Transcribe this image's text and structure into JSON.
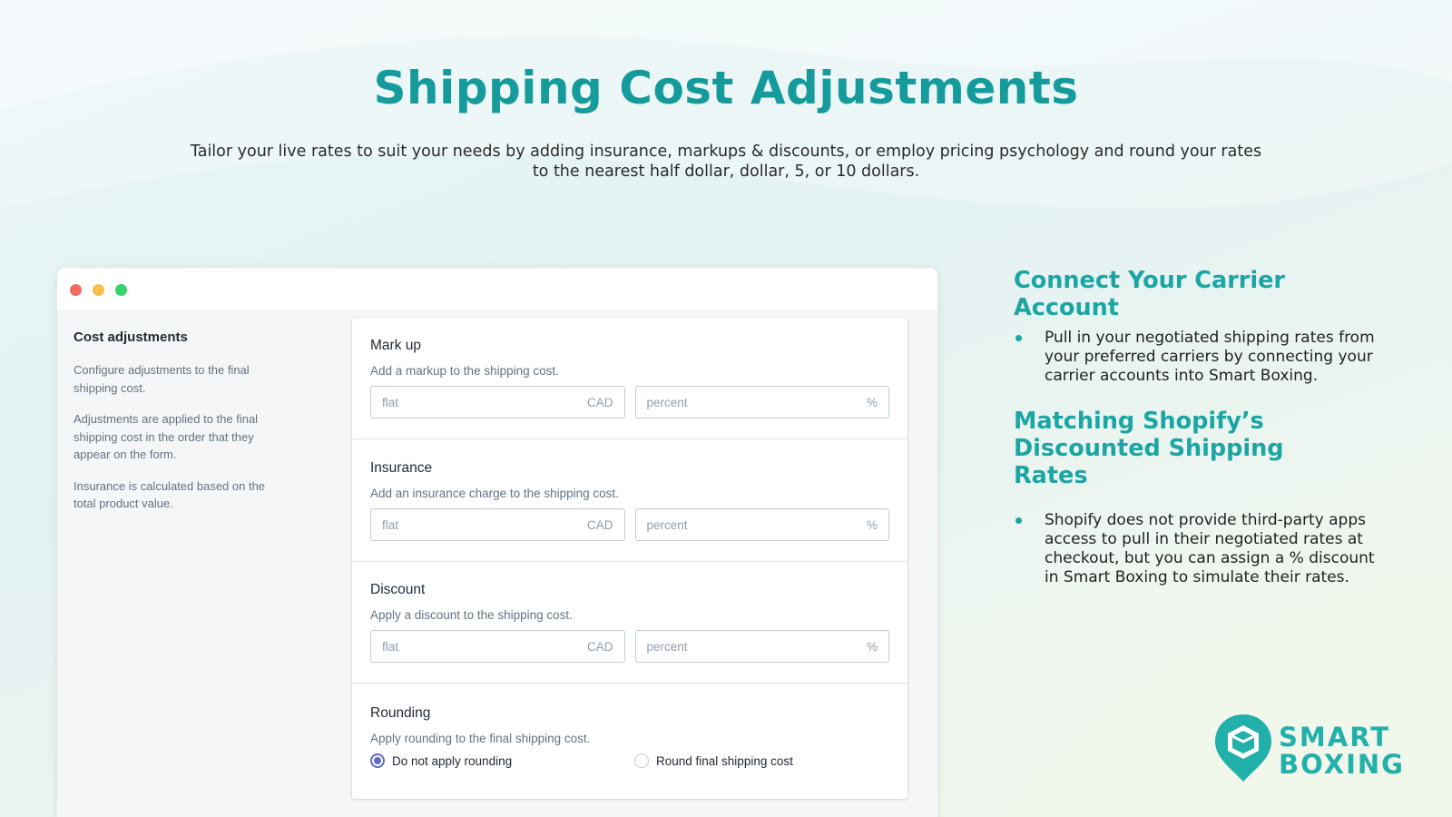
{
  "hero": {
    "title": "Shipping Cost Adjustments",
    "subtitle": "Tailor your live rates to suit your needs by adding insurance, markups & discounts, or employ pricing psychology and round your rates to the nearest half dollar, dollar, 5, or 10 dollars."
  },
  "window": {
    "sidebar": {
      "title": "Cost adjustments",
      "paragraphs": [
        "Configure adjustments to the final shipping cost.",
        "Adjustments are applied to the final shipping cost in the order that they appear on the form.",
        "Insurance is calculated based on the total product value."
      ]
    },
    "sections": {
      "markup": {
        "title": "Mark up",
        "help": "Add a markup to the shipping cost.",
        "flat_placeholder": "flat",
        "flat_suffix": "CAD",
        "percent_placeholder": "percent",
        "percent_suffix": "%"
      },
      "insurance": {
        "title": "Insurance",
        "help": "Add an insurance charge to the shipping cost.",
        "flat_placeholder": "flat",
        "flat_suffix": "CAD",
        "percent_placeholder": "percent",
        "percent_suffix": "%"
      },
      "discount": {
        "title": "Discount",
        "help": "Apply a discount to the shipping cost.",
        "flat_placeholder": "flat",
        "flat_suffix": "CAD",
        "percent_placeholder": "percent",
        "percent_suffix": "%"
      },
      "rounding": {
        "title": "Rounding",
        "help": "Apply rounding to the final shipping cost.",
        "options": [
          "Do not apply rounding",
          "Round final shipping cost"
        ],
        "selected": "Do not apply rounding"
      }
    }
  },
  "features": [
    {
      "heading": "Connect Your Carrier Account",
      "bullet": "Pull in your negotiated shipping rates from your preferred carriers by connecting your carrier accounts into Smart Boxing."
    },
    {
      "heading": "Matching Shopify’s Discounted Shipping Rates",
      "bullet": "Shopify does not provide third-party apps access to pull in their negotiated rates at checkout, but you can assign a % discount in Smart Boxing to simulate their rates."
    }
  ],
  "logo": {
    "line1": "SMART",
    "line2": "BOXING",
    "icon": "box-pin-icon"
  },
  "colors": {
    "accent": "#159b9c",
    "radio_selected": "#5c6ac4",
    "dot_red": "#f26b63",
    "dot_yellow": "#f6c04f",
    "dot_green": "#33d36a"
  }
}
